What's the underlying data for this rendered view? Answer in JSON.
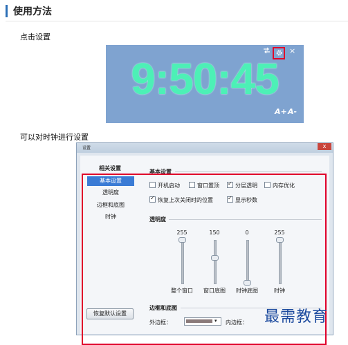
{
  "section": {
    "title": "使用方法"
  },
  "step1": {
    "label": "点击设置"
  },
  "clock": {
    "time": "9:50:45",
    "font_up": "A+",
    "font_down": "A-",
    "close_glyph": "×",
    "accent_color": "#4df0b6"
  },
  "step2": {
    "label": "可以对时钟进行设置"
  },
  "window": {
    "title": "设置",
    "close_glyph": "x",
    "nav": {
      "header": "相关设置",
      "items": [
        "基本设置",
        "透明度",
        "边框和底图",
        "时钟"
      ],
      "active_index": 0
    },
    "basic": {
      "title": "基本设置",
      "checkboxes": [
        {
          "label": "开机启动",
          "checked": false
        },
        {
          "label": "窗口置顶",
          "checked": false
        },
        {
          "label": "分层透明",
          "checked": true
        },
        {
          "label": "内存优化",
          "checked": false
        },
        {
          "label": "恢复上次关闭时的位置",
          "checked": true
        },
        {
          "label": "显示秒数",
          "checked": true
        }
      ]
    },
    "transparency": {
      "title": "透明度",
      "sliders": [
        {
          "label": "整个窗口",
          "value": "255",
          "level": 1.0
        },
        {
          "label": "窗口底图",
          "value": "150",
          "level": 0.59
        },
        {
          "label": "时钟底图",
          "value": "0",
          "level": 0.0
        },
        {
          "label": "时钟",
          "value": "255",
          "level": 1.0
        }
      ]
    },
    "border": {
      "title": "边框和底图",
      "outer_label": "外边框：",
      "inner_label": "内边框："
    },
    "reset_button": "恢复默认设置"
  },
  "watermark": "最需教育"
}
